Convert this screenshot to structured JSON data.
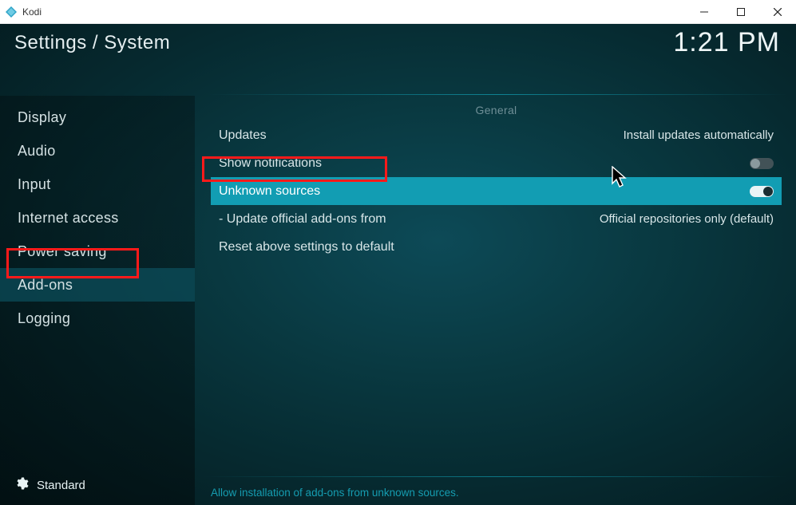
{
  "window": {
    "app_name": "Kodi"
  },
  "header": {
    "breadcrumb": "Settings / System",
    "clock": "1:21 PM"
  },
  "sidebar": {
    "items": [
      {
        "label": "Display",
        "active": false
      },
      {
        "label": "Audio",
        "active": false
      },
      {
        "label": "Input",
        "active": false
      },
      {
        "label": "Internet access",
        "active": false
      },
      {
        "label": "Power saving",
        "active": false
      },
      {
        "label": "Add-ons",
        "active": true
      },
      {
        "label": "Logging",
        "active": false
      }
    ],
    "footer_level": "Standard"
  },
  "main": {
    "section": "General",
    "rows": {
      "updates": {
        "label": "Updates",
        "value": "Install updates automatically"
      },
      "show_notifications": {
        "label": "Show notifications",
        "toggle": "off"
      },
      "unknown_sources": {
        "label": "Unknown sources",
        "toggle": "on",
        "selected": true
      },
      "update_official": {
        "label": "- Update official add-ons from",
        "value": "Official repositories only (default)"
      },
      "reset": {
        "label": "Reset above settings to default"
      }
    },
    "help": "Allow installation of add-ons from unknown sources."
  }
}
